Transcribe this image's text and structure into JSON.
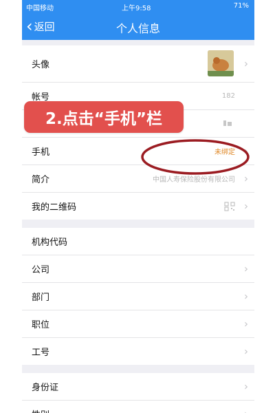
{
  "status_bar": {
    "carrier": "中国移动",
    "time": "上午9:58",
    "battery": "71%"
  },
  "nav": {
    "back_label": "返回",
    "title": "个人信息"
  },
  "groups": [
    {
      "rows": [
        {
          "label": "头像",
          "value": ""
        },
        {
          "label": "帐号",
          "value": "182"
        },
        {
          "label": "",
          "value": ""
        },
        {
          "label": "手机",
          "value": "未绑定"
        },
        {
          "label": "简介",
          "value": "中国人寿保险股份有限公司"
        },
        {
          "label": "我的二维码",
          "value": ""
        }
      ]
    },
    {
      "rows": [
        {
          "label": "机构代码",
          "value": ""
        },
        {
          "label": "公司",
          "value": ""
        },
        {
          "label": "部门",
          "value": ""
        },
        {
          "label": "职位",
          "value": ""
        },
        {
          "label": "工号",
          "value": ""
        }
      ]
    },
    {
      "rows": [
        {
          "label": "身份证",
          "value": ""
        },
        {
          "label": "性别",
          "value": ""
        }
      ]
    }
  ],
  "callout": "2.点击“手机”栏",
  "colors": {
    "nav_bg": "#2f8ef1",
    "callout_bg": "#e2504d",
    "ring": "#9b1c22",
    "unbound": "#e08a2a"
  }
}
